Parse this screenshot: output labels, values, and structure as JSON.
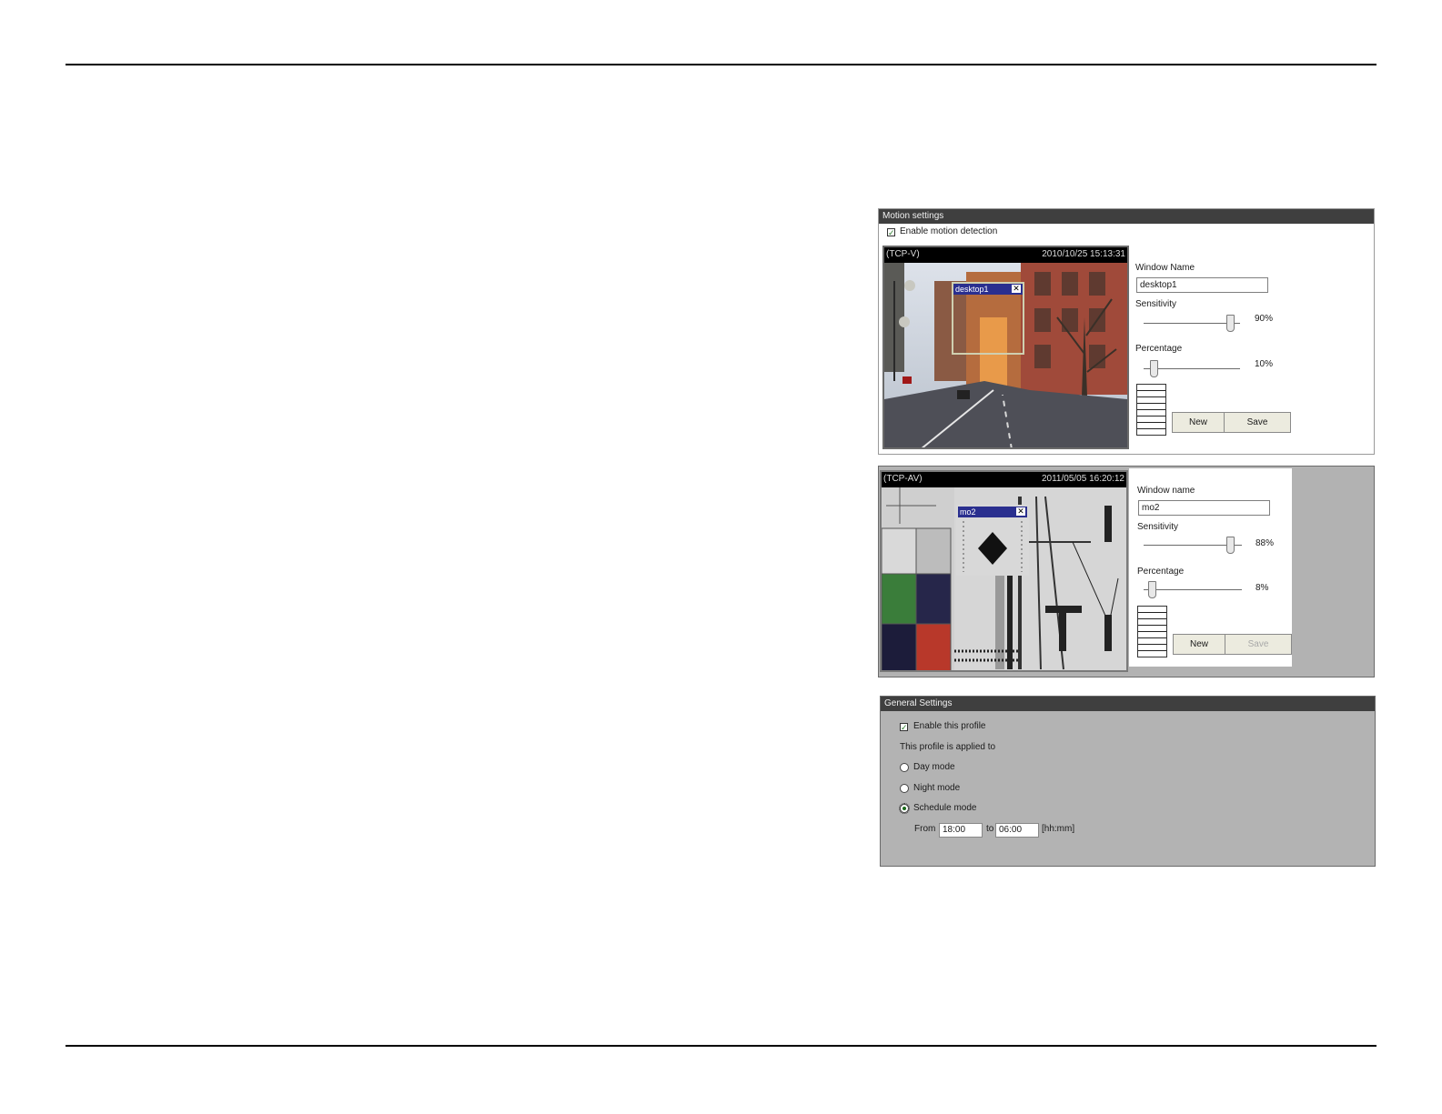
{
  "motion_settings": {
    "title": "Motion settings",
    "enable_label": "Enable motion detection",
    "enable_checked": true,
    "camera": {
      "stream": "(TCP-V)",
      "timestamp": "2010/10/25 15:13:31"
    },
    "motion_window": {
      "name": "desktop1",
      "close": "✕"
    },
    "window_name_label": "Window Name",
    "window_name_value": "desktop1",
    "sensitivity_label": "Sensitivity",
    "sensitivity_value": "90%",
    "sensitivity_level": 0.9,
    "percentage_label": "Percentage",
    "percentage_value": "10%",
    "percentage_level": 0.1,
    "new_label": "New",
    "save_label": "Save"
  },
  "motion_settings_2": {
    "camera": {
      "stream": "(TCP-AV)",
      "timestamp": "2011/05/05 16:20:12"
    },
    "motion_window": {
      "name": "mo2",
      "close": "✕"
    },
    "window_name_label": "Window name",
    "window_name_value": "mo2",
    "sensitivity_label": "Sensitivity",
    "sensitivity_value": "88%",
    "sensitivity_level": 0.88,
    "percentage_label": "Percentage",
    "percentage_value": "8%",
    "percentage_level": 0.08,
    "new_label": "New",
    "save_label": "Save",
    "save_disabled": true
  },
  "general_settings": {
    "title": "General Settings",
    "enable_profile_label": "Enable this profile",
    "enable_profile_checked": true,
    "applied_to_label": "This profile is applied to",
    "modes": [
      {
        "label": "Day mode",
        "selected": false
      },
      {
        "label": "Night mode",
        "selected": false
      },
      {
        "label": "Schedule mode",
        "selected": true
      }
    ],
    "from_label": "From",
    "from_value": "18:00",
    "to_label": "to",
    "to_value": "06:00",
    "format_label": "[hh:mm]"
  },
  "colors": {
    "titlebar": "#3f3f3f",
    "panel_gray": "#b2b2b2",
    "window_bar": "#2a2f8f",
    "check": "#2a7a2a"
  }
}
